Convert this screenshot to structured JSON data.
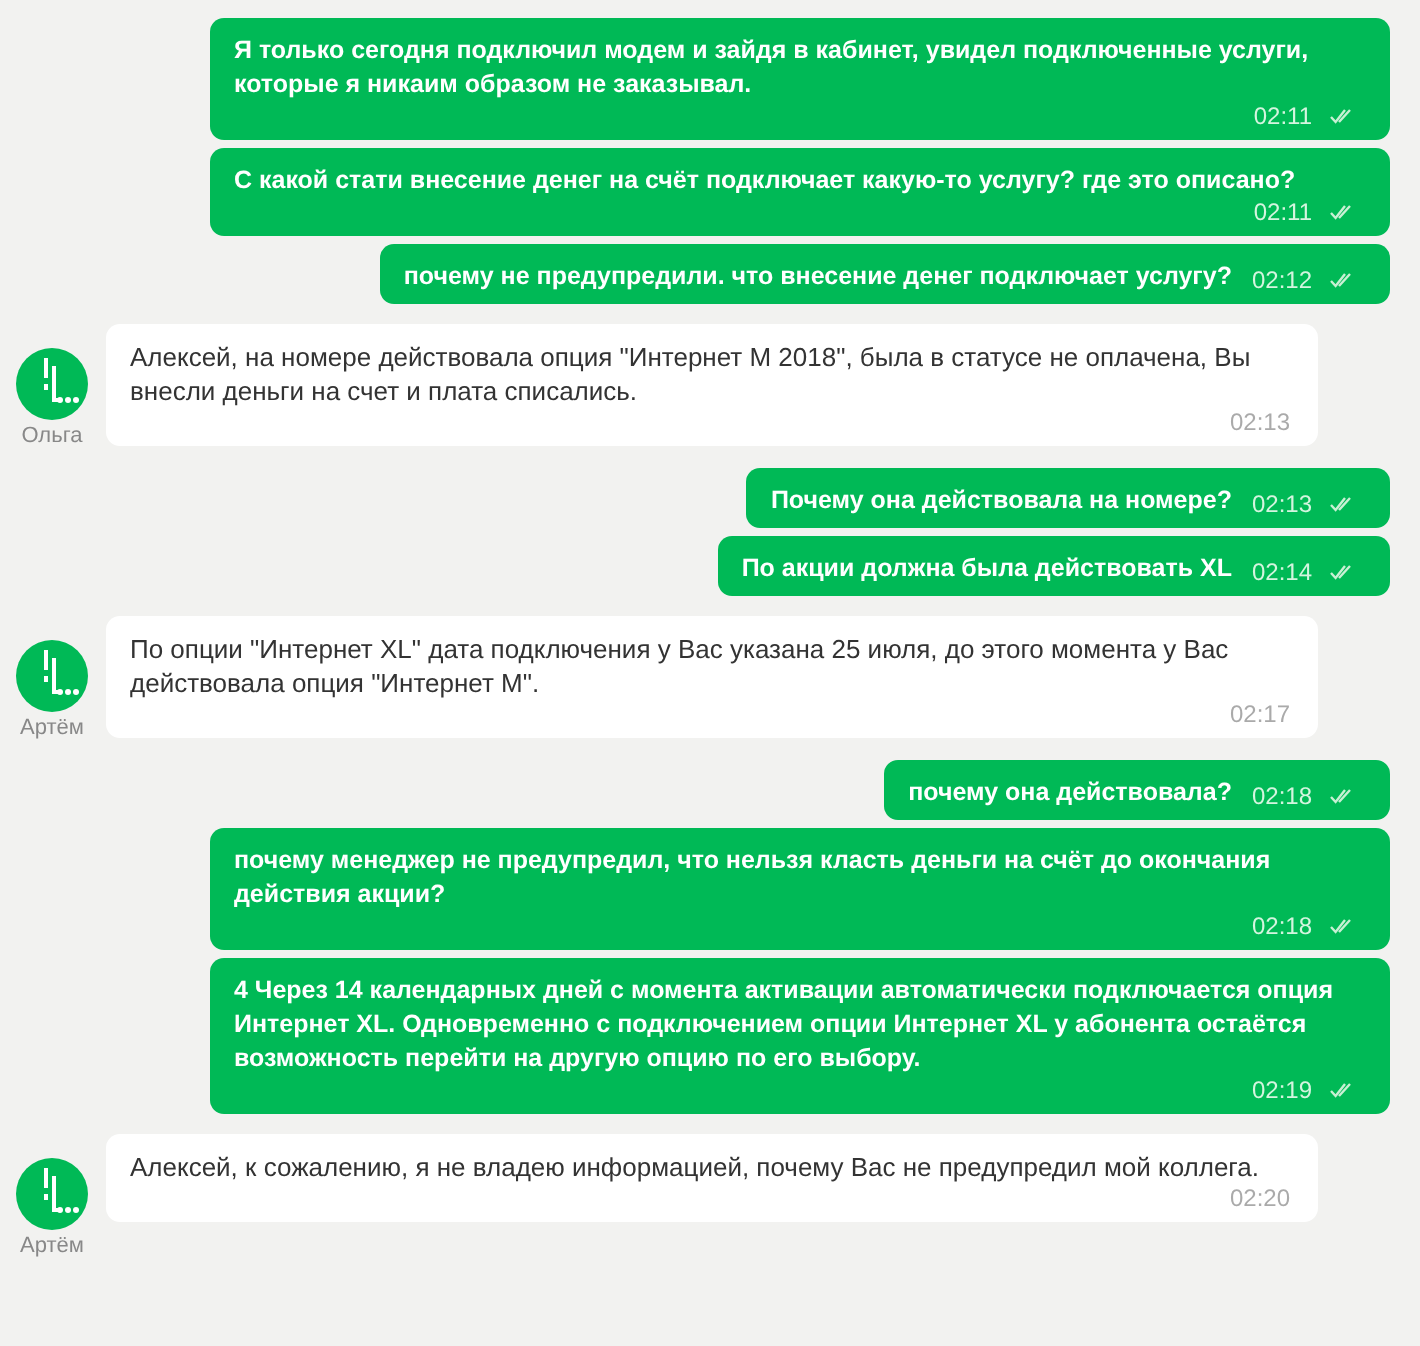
{
  "messages": [
    {
      "kind": "outgoing",
      "text": "Я только сегодня подключил модем и зайдя в кабинет, увидел подключенные услуги, которые я никаим образом не заказывал.",
      "time": "02:11",
      "read": true
    },
    {
      "kind": "outgoing",
      "text": "С какой стати внесение денег на счёт подключает какую-то услугу? где это описано?",
      "time": "02:11",
      "read": true
    },
    {
      "kind": "outgoing",
      "text": "почему не предупредили. что внесение денег подключает услугу?",
      "time": "02:12",
      "read": true
    },
    {
      "kind": "incoming",
      "text": "Алексей, на номере действовала опция \"Интернет M 2018\", была в статусе не оплачена, Вы внесли деньги на счет и плата списались.",
      "time": "02:13",
      "author": "Ольга"
    },
    {
      "kind": "outgoing",
      "text": "Почему она действовала на номере?",
      "time": "02:13",
      "read": true
    },
    {
      "kind": "outgoing",
      "text": "По акции должна была действовать XL",
      "time": "02:14",
      "read": true
    },
    {
      "kind": "incoming",
      "text": "По опции \"Интернет XL\" дата подключения у Вас указана 25 июля, до этого момента у Вас действовала опция \"Интернет M\".",
      "time": "02:17",
      "author": "Артём"
    },
    {
      "kind": "outgoing",
      "text": "почему она действовала?",
      "time": "02:18",
      "read": true
    },
    {
      "kind": "outgoing",
      "text": "почему менеджер не предупредил, что нельзя класть деньги на счёт до окончания действия акции?",
      "time": "02:18",
      "read": true
    },
    {
      "kind": "outgoing",
      "text": "4 Через 14 календарных дней с момента активации автоматически подключается опция Интернет XL. Одновременно с подключением опции Интернет XL у абонента остаётся возможность перейти на другую опцию по его выбору.",
      "time": "02:19",
      "read": true
    },
    {
      "kind": "incoming",
      "text": "Алексей, к сожалению, я не владею информацией, почему Вас не предупредил мой коллега.",
      "time": "02:20",
      "author": "Артём"
    }
  ]
}
